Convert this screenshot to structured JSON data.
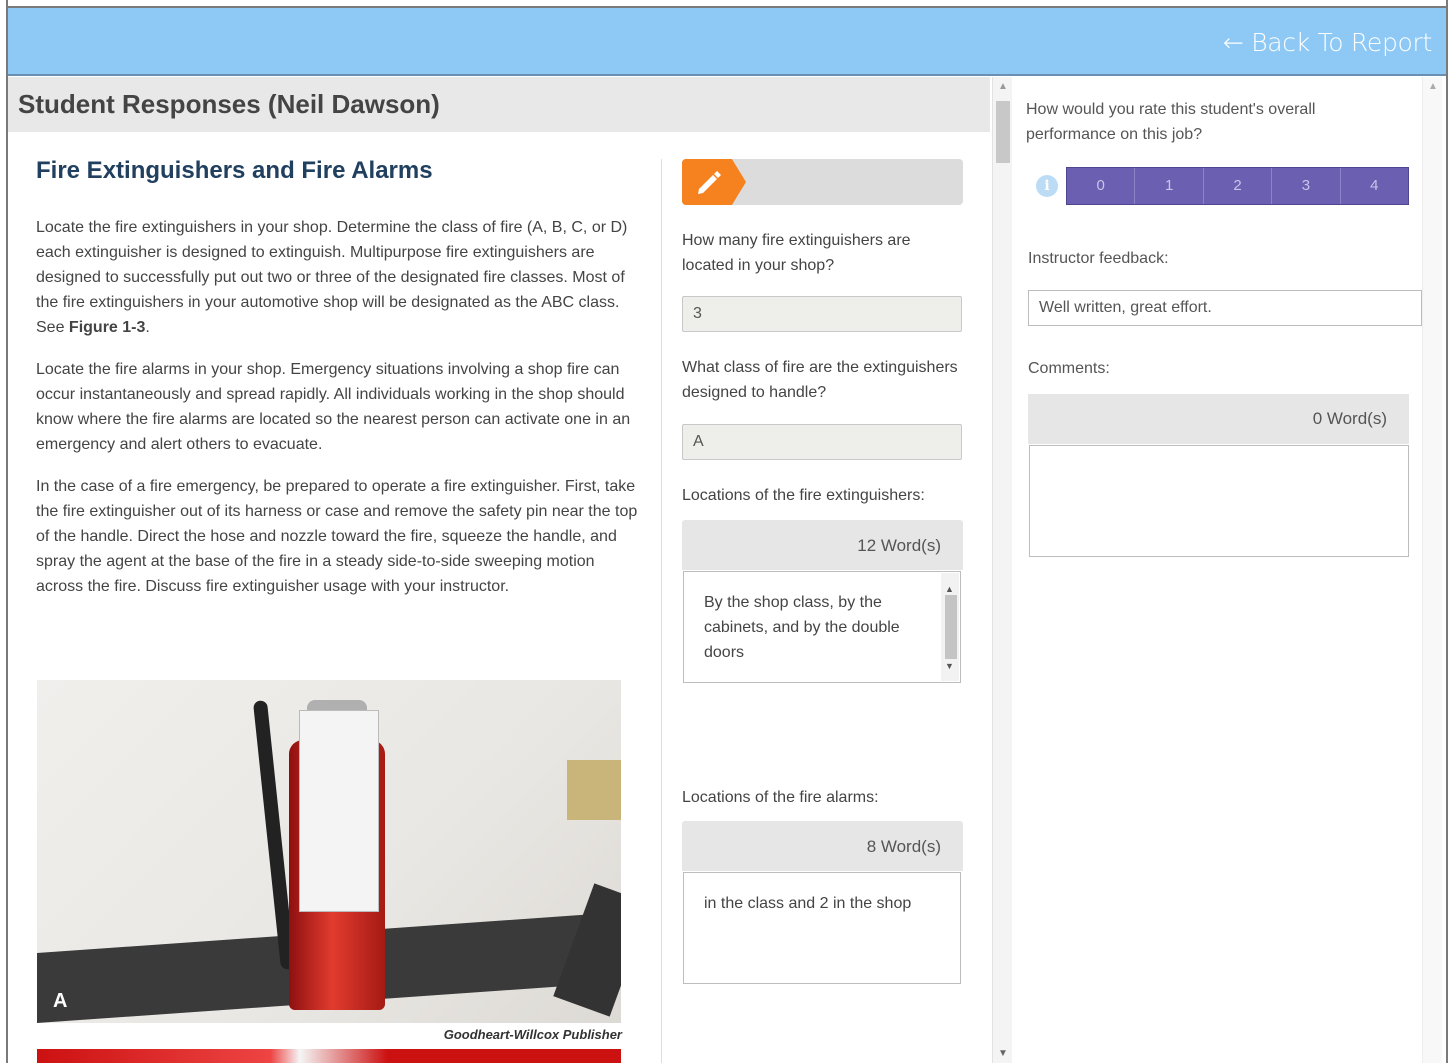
{
  "topbar": {
    "back_label": "← Back To Report"
  },
  "panel": {
    "title": "Student Responses (Neil Dawson)"
  },
  "reading": {
    "heading": "Fire Extinguishers and Fire Alarms",
    "p1_text": "Locate the fire extinguishers in your shop. Determine the class of fire (A, B, C, or D) each extinguisher is designed to extinguish. Multipurpose fire extinguishers are designed to successfully put out two or three of the designated fire classes. Most of the fire extinguishers in your automotive shop will be designated as the ABC class. See ",
    "p1_figure": "Figure 1-3",
    "p1_end": ".",
    "p2": "Locate the fire alarms in your shop. Emergency situations involving a shop fire can occur instantaneously and spread rapidly. All individuals working in the shop should know where the fire alarms are located so the nearest person can activate one in an emergency and alert others to evacuate.",
    "p3": "In the case of a fire emergency, be prepared to operate a fire extinguisher. First, take the fire extinguisher out of its harness or case and remove the safety pin near the top of the handle. Direct the hose and nozzle toward the fire, squeeze the handle, and spray the agent at the base of the fire in a steady side-to-side sweeping motion across the fire. Discuss fire extinguisher usage with your instructor.",
    "photo_letter": "A",
    "photo_credit": "Goodheart-Willcox Publisher"
  },
  "answers": {
    "icon": "pencil-icon",
    "q1": "How many fire extinguishers are located in your shop?",
    "a1": "3",
    "q2": "What class of fire are the extinguishers designed to handle?",
    "a2": "A",
    "q3": "Locations of the fire extinguishers:",
    "q3_wordcount": "12 Word(s)",
    "a3": "By the shop class, by the cabinets, and by the double doors",
    "q4": "Locations of the fire alarms:",
    "q4_wordcount": "8 Word(s)",
    "a4": "in the class and 2 in the shop"
  },
  "grading": {
    "rate_question": "How would you rate this student's overall performance on this job?",
    "rating_options": [
      "0",
      "1",
      "2",
      "3",
      "4"
    ],
    "accent_color": "#6a5fb0",
    "feedback_label": "Instructor feedback:",
    "feedback_value": "Well written, great effort.",
    "comments_label": "Comments:",
    "comments_wordcount": "0 Word(s)",
    "comments_value": ""
  }
}
